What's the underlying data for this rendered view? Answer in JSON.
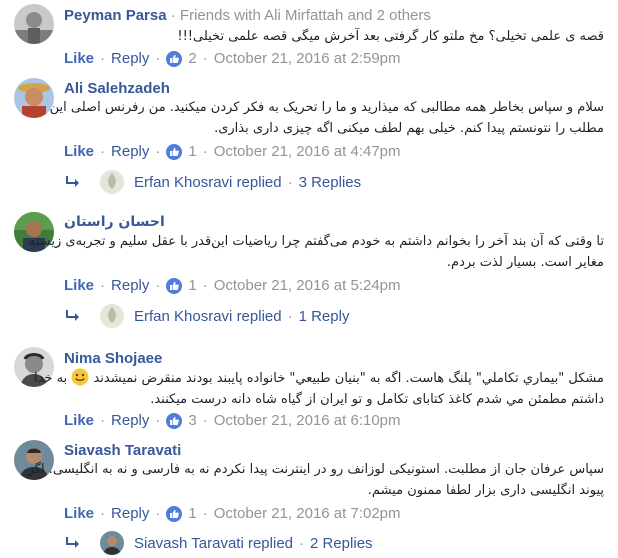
{
  "comments": [
    {
      "name": "Peyman Parsa",
      "friends_text": "Friends with Ali Mirfattah and 2 others",
      "lines": [
        "قصه ی علمی تخیلی؟ مخ ملتو کار گرفتی بعد آخرش میگی قصه علمی تخیلی!!!"
      ],
      "like_label": "Like",
      "reply_label": "Reply",
      "like_count": "2",
      "timestamp": "October 21, 2016 at 2:59pm"
    },
    {
      "name": "Ali Salehzadeh",
      "lines": [
        "سلام و سپاس بخاطر همه مطالبی که میذارید و ما را تحریک به فکر کردن میکنید. من رفرنس اصلی این",
        "مطلب را نتونستم پیدا کنم. خیلی بهم لطف میکنی اگه چیزی داری بذاری."
      ],
      "like_label": "Like",
      "reply_label": "Reply",
      "like_count": "1",
      "timestamp": "October 21, 2016 at 4:47pm",
      "replies": {
        "name": "Erfan Khosravi",
        "replied": "replied",
        "count": "3 Replies"
      }
    },
    {
      "name": "احسان راستان",
      "lines": [
        "تا وقتی که آن بند آخر را بخوانم داشتم به خودم می‌گفتم چرا ریاضیات این‌قدر با عقل سلیم و تجربه‌ی زیسته",
        "مغایر است. بسیار لذت بردم."
      ],
      "like_label": "Like",
      "reply_label": "Reply",
      "like_count": "1",
      "timestamp": "October 21, 2016 at 5:24pm",
      "replies": {
        "name": "Erfan Khosravi",
        "replied": "replied",
        "count": "1 Reply"
      }
    },
    {
      "name": "Nima Shojaee",
      "lines": [
        "مشکل \"بيماري تکاملي\" پلنگ هاست. اگه به \"بنيان طبيعي\" خانواده پايبند بودند منقرض نميشدند",
        "به خدا",
        "داشتم مطمئن مي شدم کاغذ کتابای تکامل و تو ایران از گیاه شاه دانه درست میکنند."
      ],
      "like_label": "Like",
      "reply_label": "Reply",
      "like_count": "3",
      "timestamp": "October 21, 2016 at 6:10pm"
    },
    {
      "name": "Siavash Taravati",
      "lines": [
        "سپاس عرفان جان از مطلبت. استونیکی لوزانف رو در اینترنت پیدا نکردم نه به فارسی و نه به انگلیسی. اگر",
        "پیوند انگلیسی داری بزار لطفا ممنون میشم."
      ],
      "like_label": "Like",
      "reply_label": "Reply",
      "like_count": "1",
      "timestamp": "October 21, 2016 at 7:02pm",
      "replies": {
        "name": "Siavash Taravati",
        "replied": "replied",
        "count": "2 Replies"
      }
    }
  ],
  "separator": "·",
  "colors": {
    "link": "#385898",
    "meta": "#90949c",
    "like_bubble": "#4f7ddd"
  },
  "icons": {
    "like": "thumbs-up-icon",
    "reply_arrow": "reply-arrow-icon",
    "emoji": "smiley-emoji-icon"
  }
}
